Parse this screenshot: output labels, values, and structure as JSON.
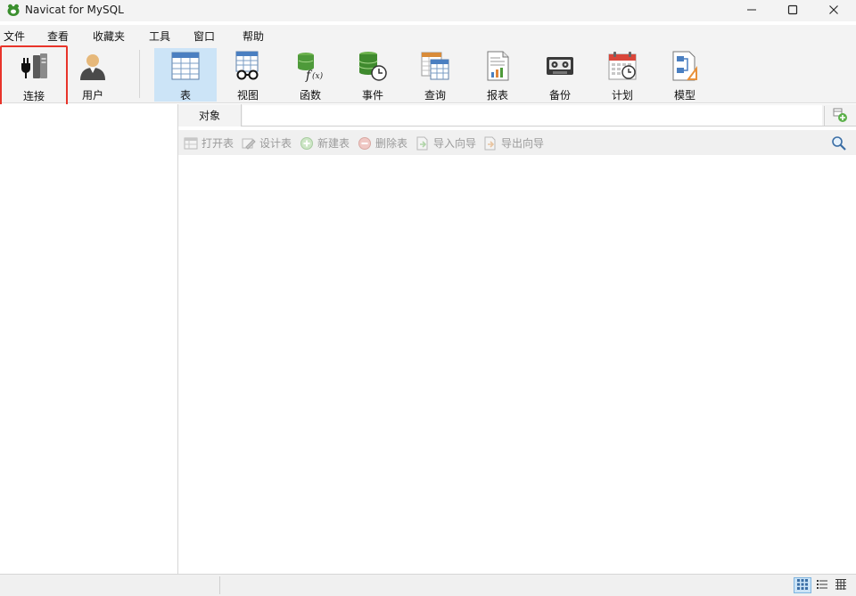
{
  "window": {
    "title": "Navicat for MySQL",
    "app_icon": "navicat-leaf-icon",
    "controls": [
      "minimize-icon",
      "maximize-icon",
      "close-icon"
    ]
  },
  "menu": {
    "items": [
      {
        "label": "文件"
      },
      {
        "label": "查看"
      },
      {
        "label": "收藏夹"
      },
      {
        "label": "工具"
      },
      {
        "label": "窗口"
      },
      {
        "label": "帮助"
      }
    ]
  },
  "toolbar": {
    "tools": [
      {
        "label": "连接",
        "icon": "connection-plug-icon",
        "highlighted": true
      },
      {
        "label": "用户",
        "icon": "user-icon"
      },
      {
        "label": "表",
        "icon": "table-icon",
        "active": true
      },
      {
        "label": "视图",
        "icon": "view-glasses-icon"
      },
      {
        "label": "函数",
        "icon": "function-fx-icon"
      },
      {
        "label": "事件",
        "icon": "event-clock-icon"
      },
      {
        "label": "查询",
        "icon": "query-table-icon"
      },
      {
        "label": "报表",
        "icon": "report-icon"
      },
      {
        "label": "备份",
        "icon": "backup-tape-icon"
      },
      {
        "label": "计划",
        "icon": "calendar-schedule-icon"
      },
      {
        "label": "模型",
        "icon": "model-diagram-icon"
      }
    ]
  },
  "tabs": {
    "objects_label": "对象"
  },
  "actions": {
    "items": [
      {
        "label": "打开表",
        "icon": "open-table-icon",
        "enabled": false
      },
      {
        "label": "设计表",
        "icon": "design-table-icon",
        "enabled": false
      },
      {
        "label": "新建表",
        "icon": "add-table-icon",
        "enabled": false
      },
      {
        "label": "删除表",
        "icon": "delete-table-icon",
        "enabled": false
      },
      {
        "label": "导入向导",
        "icon": "import-wizard-icon",
        "enabled": false
      },
      {
        "label": "导出向导",
        "icon": "export-wizard-icon",
        "enabled": false
      }
    ],
    "search_icon": "search-icon"
  },
  "statusbar": {
    "view_modes": [
      "large-icons-view-icon",
      "list-view-icon",
      "detail-grid-view-icon"
    ],
    "active_view": "large-icons-view-icon"
  },
  "colors": {
    "highlight_border": "#e8342a",
    "active_tool_bg": "#cce4f7",
    "disabled_text": "#9a9a9a"
  }
}
